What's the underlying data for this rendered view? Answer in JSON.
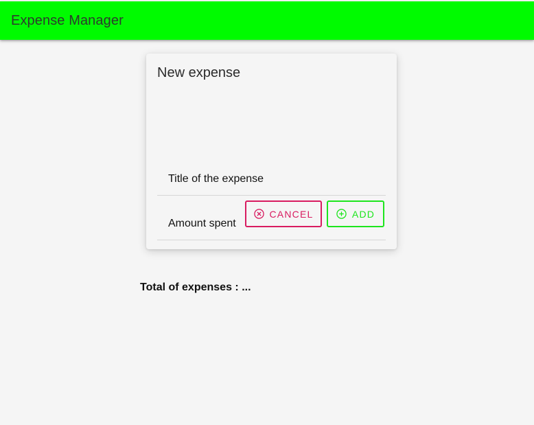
{
  "appbar": {
    "title": "Expense Manager",
    "color": "#00fb00"
  },
  "form": {
    "heading": "New expense",
    "title_field": {
      "placeholder": "Title of the expense",
      "value": ""
    },
    "amount_field": {
      "placeholder": "Amount spent",
      "value": ""
    },
    "cancel_button": {
      "label": "CANCEL",
      "icon": "cancel-circle-icon",
      "color": "#d81b60"
    },
    "add_button": {
      "label": "ADD",
      "icon": "add-circle-icon",
      "color": "#1de51d"
    }
  },
  "summary": {
    "label": "Total of expenses :",
    "value": "..."
  }
}
